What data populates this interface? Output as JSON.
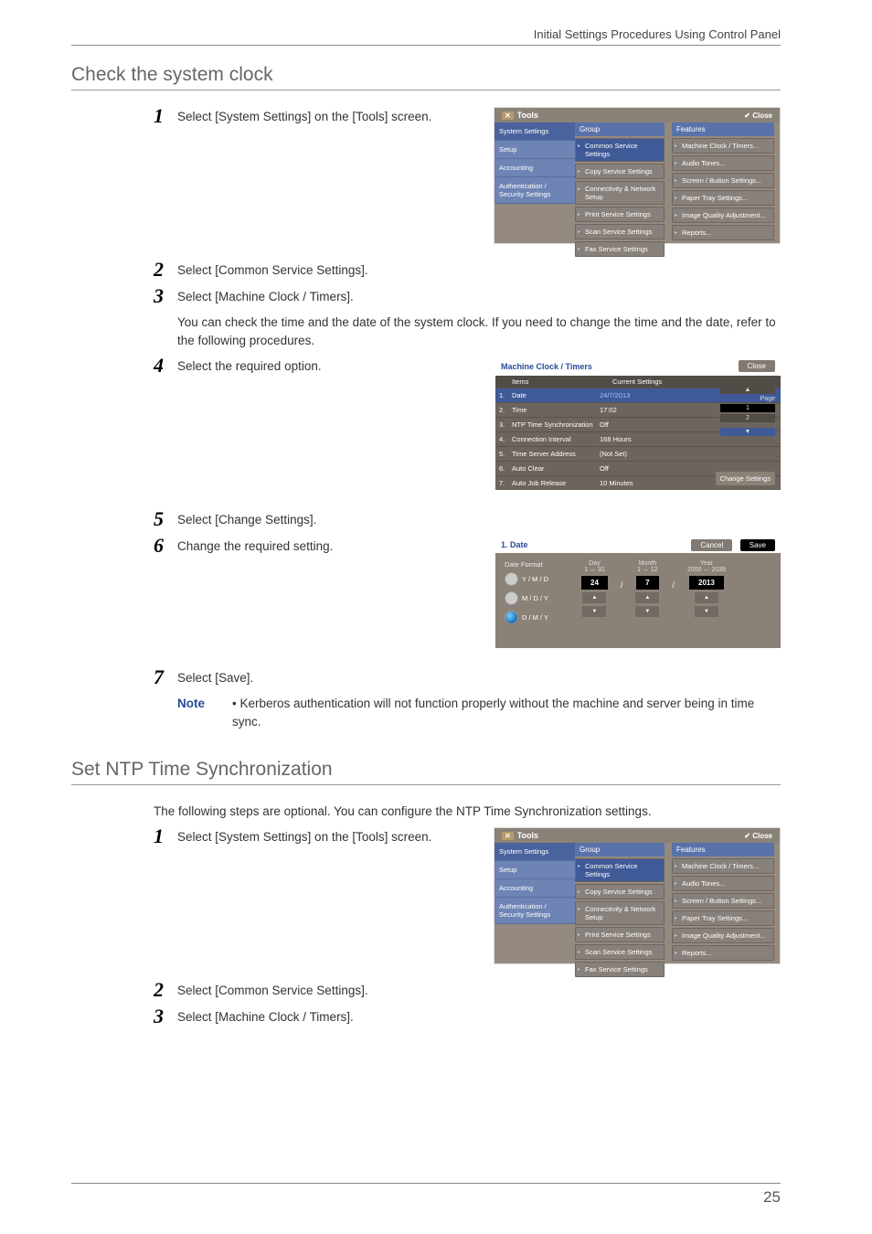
{
  "header_right": "Initial Settings Procedures Using Control Panel",
  "page_number": "25",
  "sections": {
    "clock": {
      "title": "Check the system clock",
      "step1": "Select [System Settings] on the [Tools] screen.",
      "step2": "Select [Common Service Settings].",
      "step3": "Select [Machine Clock / Timers].",
      "para3": "You can check the time and the date of the system clock. If you need to change the time and the date, refer to the following procedures.",
      "step4": "Select the required option.",
      "step5": "Select [Change Settings].",
      "step6": "Change the required setting.",
      "step7": "Select [Save].",
      "note_label": "Note",
      "note_bullet": "•",
      "note_text": "Kerberos authentication will not function properly without the machine and server being in time sync."
    },
    "ntp": {
      "title": "Set NTP Time Synchronization",
      "intro": "The following steps are optional. You can configure the NTP Time Synchronization settings.",
      "step1": "Select [System Settings] on the [Tools] screen.",
      "step2": "Select [Common Service Settings].",
      "step3": "Select [Machine Clock / Timers]."
    }
  },
  "tools_screen": {
    "title": "Tools",
    "close": "✔ Close",
    "side": {
      "system_settings": "System Settings",
      "setup": "Setup",
      "accounting": "Accounting",
      "auth": "Authentication / Security Settings"
    },
    "group_label": "Group",
    "features_label": "Features",
    "group": {
      "common": "Common Service Settings",
      "copy": "Copy Service Settings",
      "conn": "Connectivity & Network Setup",
      "print": "Print Service Settings",
      "scan": "Scan Service Settings",
      "fax": "Fax Service Settings"
    },
    "features": {
      "clock": "Machine Clock / Timers...",
      "audio": "Audio Tones...",
      "screen": "Screen / Button Settings...",
      "tray": "Paper Tray Settings...",
      "image": "Image Quality Adjustment...",
      "reports": "Reports..."
    }
  },
  "clock_list": {
    "title": "Machine Clock / Timers",
    "close": "Close",
    "col_items": "Items",
    "col_current": "Current Settings",
    "page_label": "Page",
    "page_cur": "1",
    "page_tot": "2",
    "change_btn": "Change Settings",
    "rows": [
      {
        "n": "1.",
        "name": "Date",
        "val": "24/7/2013"
      },
      {
        "n": "2.",
        "name": "Time",
        "val": "17:02"
      },
      {
        "n": "3.",
        "name": "NTP Time Synchronization",
        "val": "Off"
      },
      {
        "n": "4.",
        "name": "Connection Interval",
        "val": "168 Hours"
      },
      {
        "n": "5.",
        "name": "Time Server Address",
        "val": "(Not Set)"
      },
      {
        "n": "6.",
        "name": "Auto Clear",
        "val": "Off"
      },
      {
        "n": "7.",
        "name": "Auto Job Release",
        "val": "10 Minutes"
      }
    ]
  },
  "date_edit": {
    "title": "1. Date",
    "cancel": "Cancel",
    "save": "Save",
    "format_label": "Date Format",
    "opts": {
      "ymd": "Y / M / D",
      "mdy": "M / D / Y",
      "dmy": "D / M / Y"
    },
    "day_label": "Day",
    "day_range": "1 ↔ 31",
    "day_val": "24",
    "month_label": "Month",
    "month_range": "1 ↔ 12",
    "month_val": "7",
    "year_label": "Year",
    "year_range": "2000 ↔ 2039",
    "year_val": "2013"
  }
}
